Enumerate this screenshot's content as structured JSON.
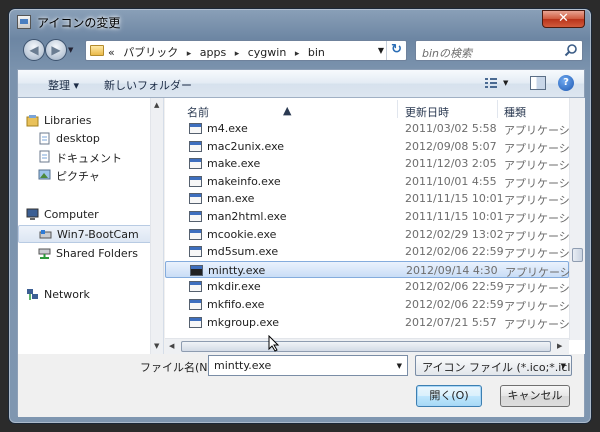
{
  "window": {
    "title": "アイコンの変更",
    "close_label": "✕"
  },
  "address": {
    "prefix": "«",
    "crumbs": [
      "パブリック",
      "apps",
      "cygwin",
      "bin"
    ],
    "separator": "▸"
  },
  "search": {
    "placeholder": "binの検索"
  },
  "toolbar": {
    "organize": "整理 ▾",
    "new_folder": "新しいフォルダー",
    "help": "?"
  },
  "nav": {
    "libraries": "Libraries",
    "desktop": "desktop",
    "documents": "ドキュメント",
    "pictures": "ピクチャ",
    "computer": "Computer",
    "drive": "Win7-BootCam",
    "shared": "Shared Folders",
    "network": "Network"
  },
  "columns": {
    "name": "名前",
    "date": "更新日時",
    "type": "種類"
  },
  "files": [
    {
      "name": "m4.exe",
      "date": "2011/03/02 5:58",
      "type": "アプリケーション"
    },
    {
      "name": "mac2unix.exe",
      "date": "2012/09/08 5:07",
      "type": "アプリケーション"
    },
    {
      "name": "make.exe",
      "date": "2011/12/03 2:05",
      "type": "アプリケーション"
    },
    {
      "name": "makeinfo.exe",
      "date": "2011/10/01 4:55",
      "type": "アプリケーション"
    },
    {
      "name": "man.exe",
      "date": "2011/11/15 10:01",
      "type": "アプリケーション"
    },
    {
      "name": "man2html.exe",
      "date": "2011/11/15 10:01",
      "type": "アプリケーション"
    },
    {
      "name": "mcookie.exe",
      "date": "2012/02/29 13:02",
      "type": "アプリケーション"
    },
    {
      "name": "md5sum.exe",
      "date": "2012/02/06 22:59",
      "type": "アプリケーション"
    },
    {
      "name": "mintty.exe",
      "date": "2012/09/14 4:30",
      "type": "アプリケーション"
    },
    {
      "name": "mkdir.exe",
      "date": "2012/02/06 22:59",
      "type": "アプリケーション"
    },
    {
      "name": "mkfifo.exe",
      "date": "2012/02/06 22:59",
      "type": "アプリケーション"
    },
    {
      "name": "mkgroup.exe",
      "date": "2012/07/21 5:57",
      "type": "アプリケーション"
    }
  ],
  "selected_index": 8,
  "filename": {
    "label": "ファイル名(N):",
    "value": "mintty.exe"
  },
  "filetype": {
    "value": "アイコン ファイル (*.ico;*.icl"
  },
  "buttons": {
    "open": "開く(O)",
    "cancel": "キャンセル"
  }
}
